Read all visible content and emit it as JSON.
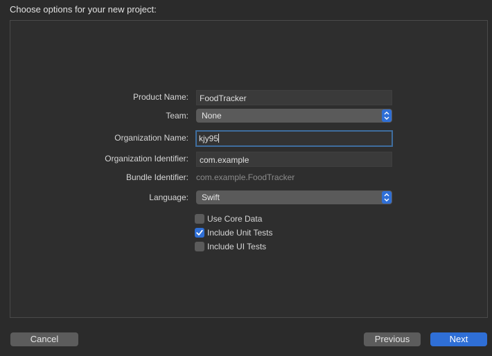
{
  "header": {
    "title": "Choose options for your new project:"
  },
  "form": {
    "product_name": {
      "label": "Product Name:",
      "value": "FoodTracker"
    },
    "team": {
      "label": "Team:",
      "value": "None"
    },
    "organization_name": {
      "label": "Organization Name:",
      "value": "kjy95"
    },
    "organization_identifier": {
      "label": "Organization Identifier:",
      "value": "com.example"
    },
    "bundle_identifier": {
      "label": "Bundle Identifier:",
      "value": "com.example.FoodTracker"
    },
    "language": {
      "label": "Language:",
      "value": "Swift"
    },
    "checkboxes": [
      {
        "label": "Use Core Data",
        "checked": false
      },
      {
        "label": "Include Unit Tests",
        "checked": true
      },
      {
        "label": "Include UI Tests",
        "checked": false
      }
    ]
  },
  "footer": {
    "cancel_label": "Cancel",
    "previous_label": "Previous",
    "next_label": "Next"
  },
  "colors": {
    "accent": "#2f6fd6",
    "focus_ring": "#3f6e9f",
    "background": "#2b2b2b"
  }
}
